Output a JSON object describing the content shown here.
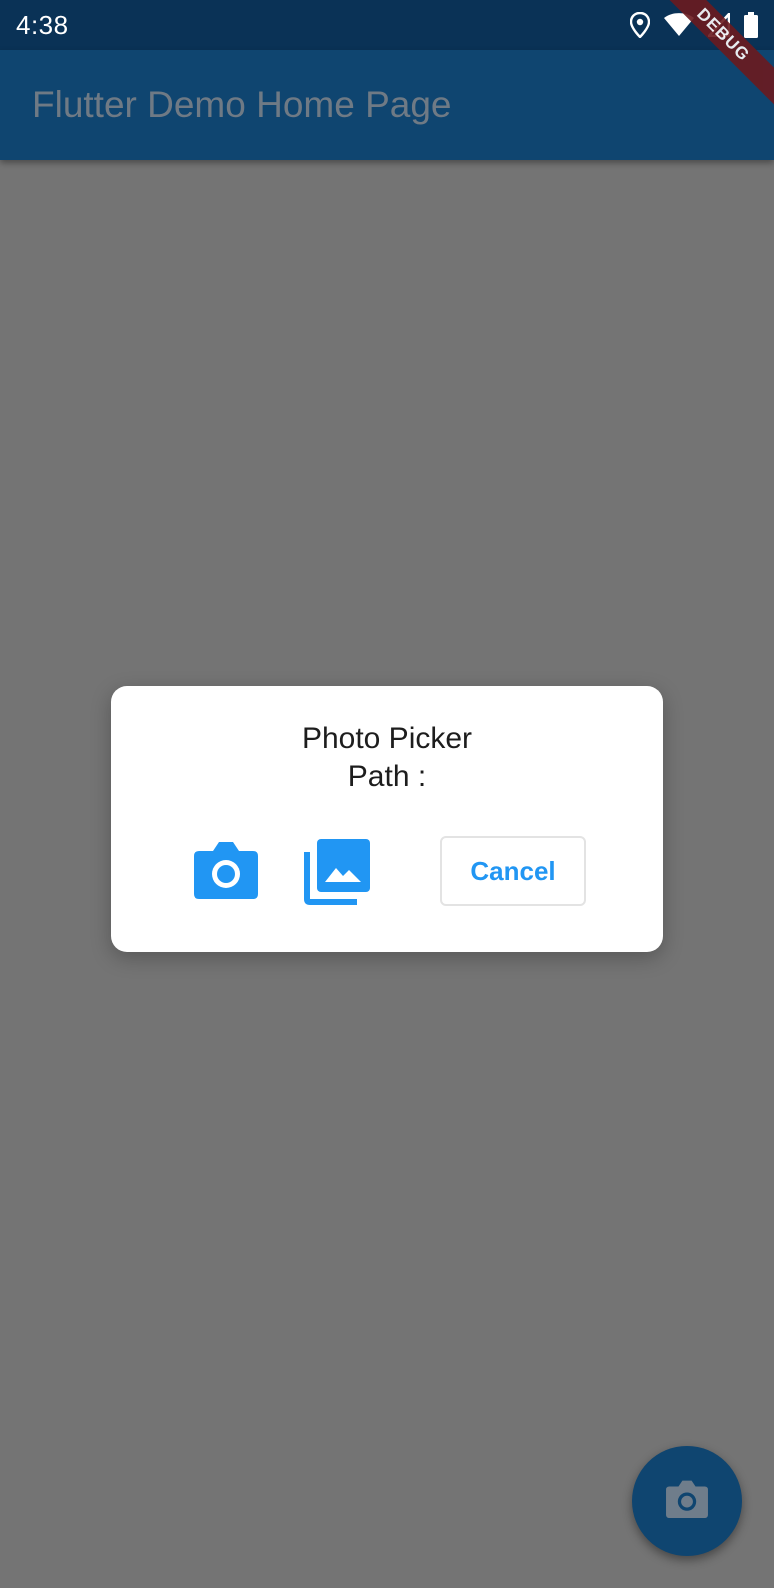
{
  "status_bar": {
    "time": "4:38",
    "icons": [
      "location-icon",
      "wifi-icon",
      "signal-icon",
      "battery-icon"
    ]
  },
  "app_bar": {
    "title": "Flutter Demo Home Page",
    "debug_banner": "DEBUG"
  },
  "dialog": {
    "title": "Photo Picker",
    "path_label": "Path :",
    "camera_icon": "camera-icon",
    "gallery_icon": "photo-library-icon",
    "cancel_label": "Cancel"
  },
  "fab": {
    "icon": "camera-icon"
  },
  "colors": {
    "accent": "#2196f3",
    "app_bar": "#0f4570",
    "status_bar": "#0a3256",
    "scrim_background": "#747474",
    "debug_banner": "#6b1a1f"
  }
}
